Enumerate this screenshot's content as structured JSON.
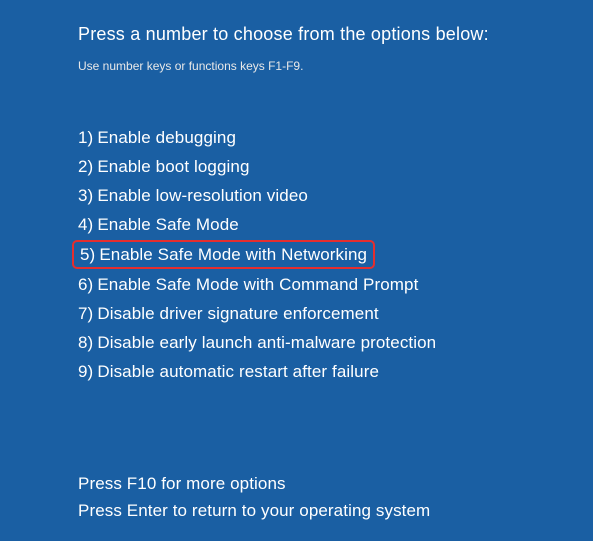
{
  "title": "Press a number to choose from the options below:",
  "subtitle": "Use number keys or functions keys F1-F9.",
  "options": [
    {
      "num": "1)",
      "label": "Enable debugging",
      "highlighted": false
    },
    {
      "num": "2)",
      "label": "Enable boot logging",
      "highlighted": false
    },
    {
      "num": "3)",
      "label": "Enable low-resolution video",
      "highlighted": false
    },
    {
      "num": "4)",
      "label": "Enable Safe Mode",
      "highlighted": false
    },
    {
      "num": "5)",
      "label": "Enable Safe Mode with Networking",
      "highlighted": true
    },
    {
      "num": "6)",
      "label": "Enable Safe Mode with Command Prompt",
      "highlighted": false
    },
    {
      "num": "7)",
      "label": "Disable driver signature enforcement",
      "highlighted": false
    },
    {
      "num": "8)",
      "label": "Disable early launch anti-malware protection",
      "highlighted": false
    },
    {
      "num": "9)",
      "label": "Disable automatic restart after failure",
      "highlighted": false
    }
  ],
  "footer": {
    "line1": "Press F10 for more options",
    "line2": "Press Enter to return to your operating system"
  }
}
